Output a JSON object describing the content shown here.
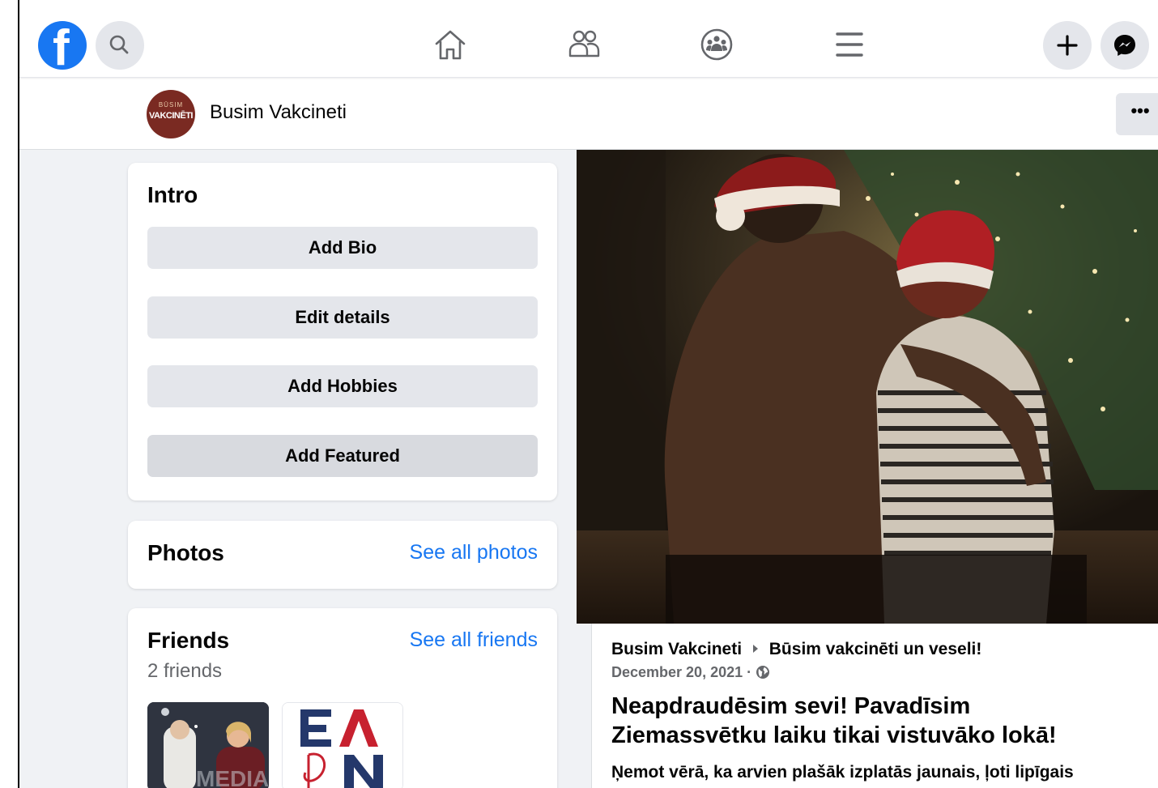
{
  "nav": {
    "logo": "f",
    "icons": [
      "search-icon",
      "home-icon",
      "friends-icon",
      "groups-icon",
      "menu-icon",
      "create-icon",
      "messenger-icon"
    ]
  },
  "profile": {
    "avatar_line1": "BŪSIM",
    "avatar_line2": "VAKCINĒTI",
    "name": "Busim Vakcineti",
    "more": "•••"
  },
  "intro": {
    "title": "Intro",
    "buttons": [
      "Add Bio",
      "Edit details",
      "Add Hobbies",
      "Add Featured"
    ]
  },
  "photos": {
    "title": "Photos",
    "link": "See all photos"
  },
  "friends": {
    "title": "Friends",
    "link": "See all friends",
    "count": "2 friends",
    "thumb2_text": "EAPN"
  },
  "post": {
    "author": "Busim Vakcineti",
    "target": "Būsim vakcinēti un veseli!",
    "date": "December 20, 2021 ·",
    "title": "Neapdraudēsim sevi! Pavadīsim Ziemassvētku laiku tikai vistuvāko lokā!",
    "text": "Ņemot vērā, ka arvien plašāk izplatās jaunais, ļoti lipīgais"
  },
  "colors": {
    "brand": "#1877f2",
    "button_bg": "#e4e6eb",
    "page_bg": "#f0f2f5"
  }
}
